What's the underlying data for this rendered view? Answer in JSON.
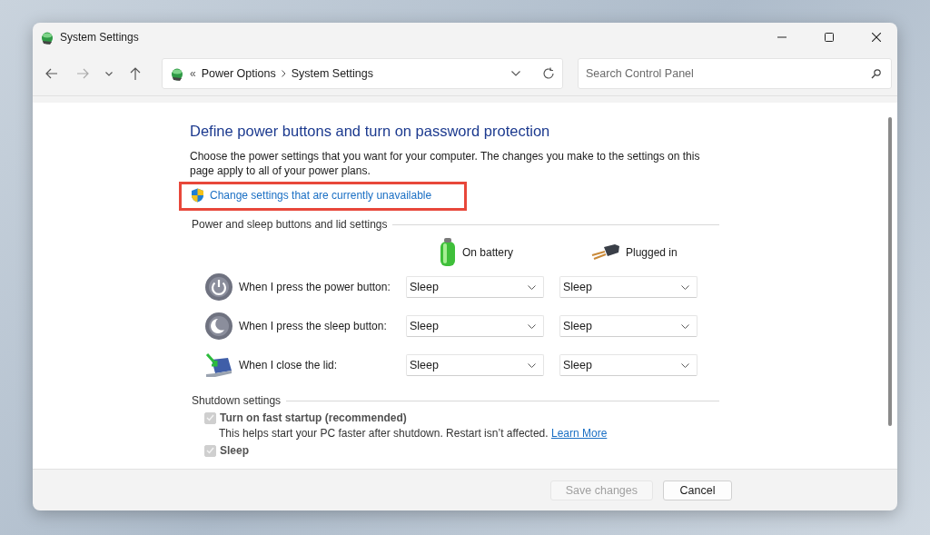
{
  "window": {
    "title": "System Settings"
  },
  "address": {
    "overflow": "«",
    "crumbs": [
      "Power Options",
      "System Settings"
    ]
  },
  "search": {
    "placeholder": "Search Control Panel"
  },
  "page": {
    "heading": "Define power buttons and turn on password protection",
    "description": "Choose the power settings that you want for your computer. The changes you make to the settings on this page apply to all of your power plans.",
    "admin_link": {
      "text": "Change settings that are currently unavailable",
      "highlighted": true
    },
    "buttons_section": {
      "title": "Power and sleep buttons and lid settings",
      "columns": [
        {
          "label": "On battery",
          "kind": "battery"
        },
        {
          "label": "Plugged in",
          "kind": "plug"
        }
      ],
      "rows": [
        {
          "kind": "power",
          "label": "When I press the power button:",
          "values": [
            "Sleep",
            "Sleep"
          ]
        },
        {
          "kind": "sleep",
          "label": "When I press the sleep button:",
          "values": [
            "Sleep",
            "Sleep"
          ]
        },
        {
          "kind": "lid",
          "label": "When I close the lid:",
          "values": [
            "Sleep",
            "Sleep"
          ]
        }
      ]
    },
    "shutdown_section": {
      "title": "Shutdown settings",
      "options": [
        {
          "label": "Turn on fast startup (recommended)",
          "checked": true,
          "disabled": true,
          "description": "This helps start your PC faster after shutdown. Restart isn’t affected.",
          "link": "Learn More"
        },
        {
          "label": "Sleep",
          "checked": true,
          "disabled": true
        }
      ]
    }
  },
  "footer": {
    "buttons": [
      {
        "label": "Save changes",
        "disabled": true
      },
      {
        "label": "Cancel",
        "disabled": false
      }
    ]
  }
}
